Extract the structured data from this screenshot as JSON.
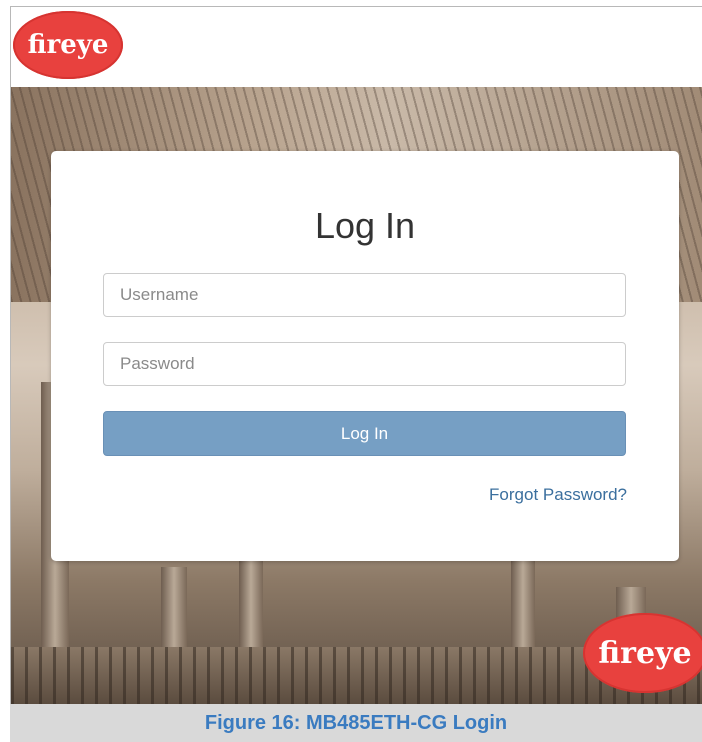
{
  "brand": {
    "logo_text": "fireye",
    "logo_color": "#e8413e"
  },
  "login": {
    "title": "Log In",
    "username_placeholder": "Username",
    "password_placeholder": "Password",
    "submit_label": "Log In",
    "forgot_password_label": "Forgot Password?",
    "button_color": "#769fc4",
    "link_color": "#3b6f9e"
  },
  "caption": {
    "text": "Figure 16: MB485ETH-CG Login",
    "color": "#3a7bc0"
  }
}
